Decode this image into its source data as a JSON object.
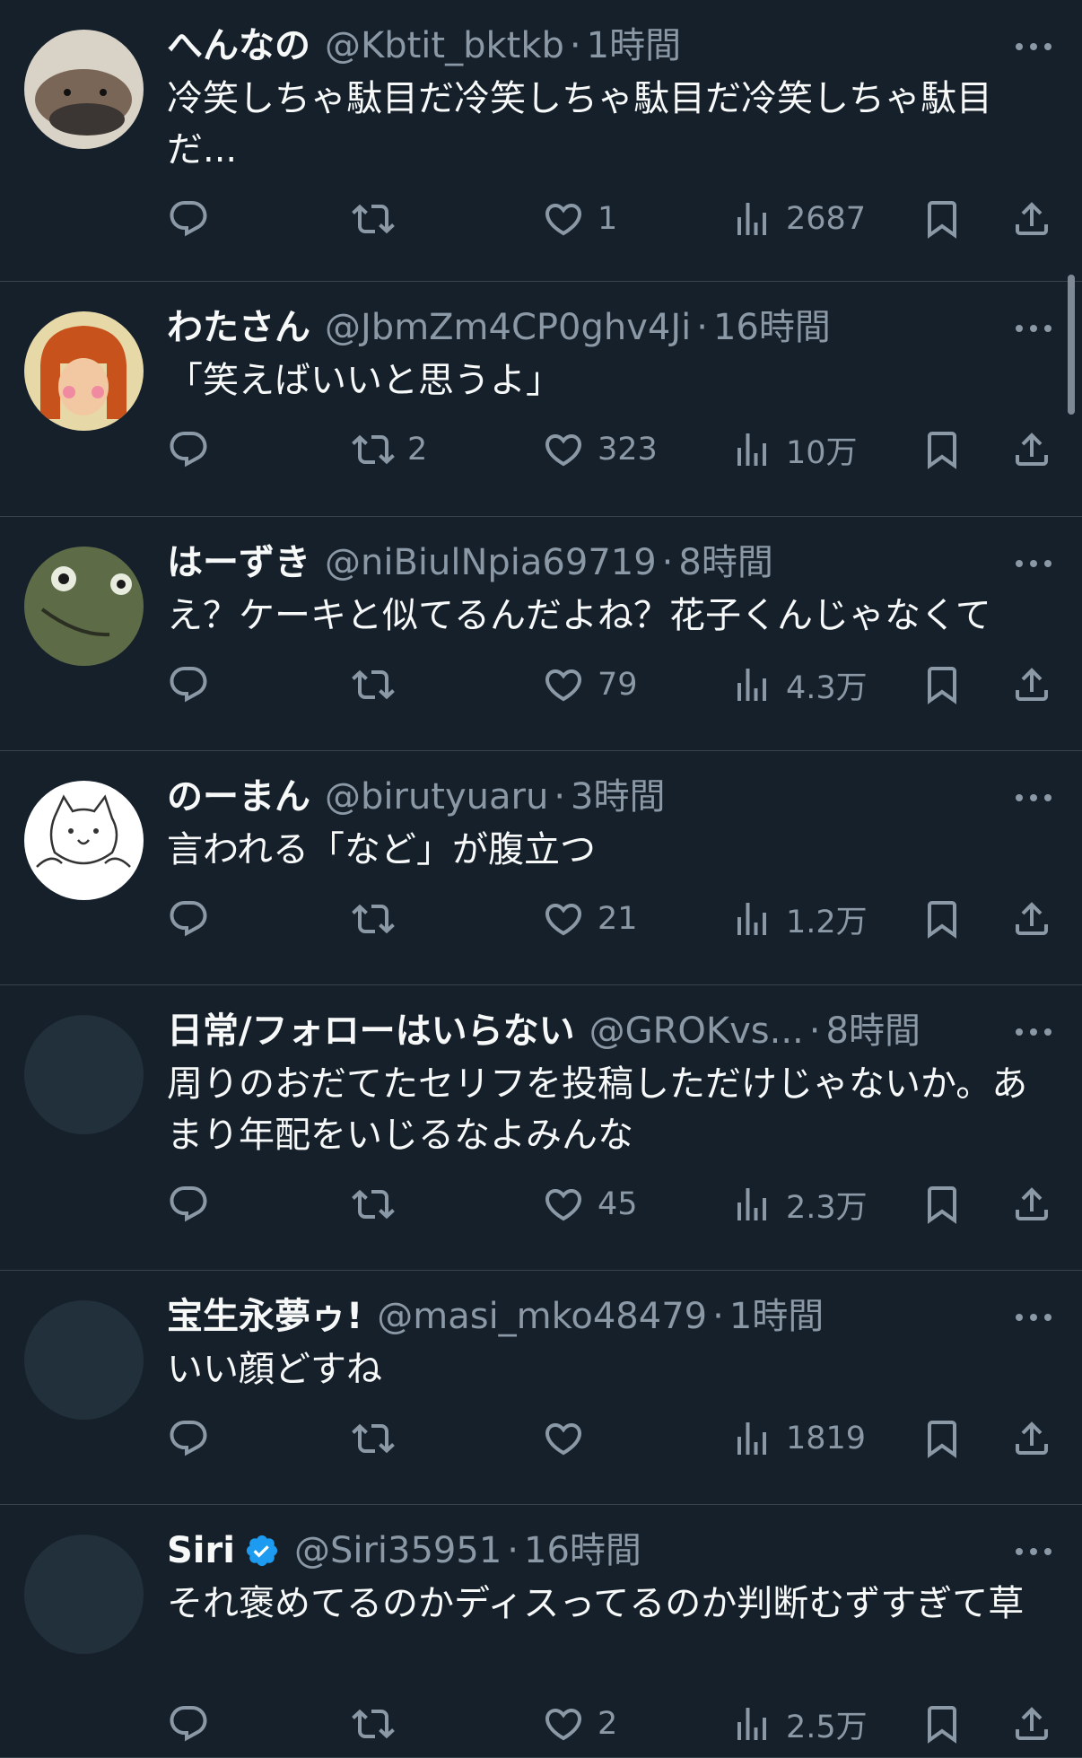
{
  "tweets": [
    {
      "name": "へんなの",
      "handle": "@Kbtit_bktkb",
      "time": "1時間",
      "text": "冷笑しちゃ駄目だ冷笑しちゃ駄目だ冷笑しちゃ駄目だ...",
      "retweets": "",
      "likes": "1",
      "views": "2687",
      "avatar": "platypus",
      "verified": false
    },
    {
      "name": "わたさん",
      "handle": "@JbmZm4CP0ghv4Ji",
      "time": "16時間",
      "text": "「笑えばいいと思うよ」",
      "retweets": "2",
      "likes": "323",
      "views": "10万",
      "avatar": "girl",
      "verified": false
    },
    {
      "name": "はーずき",
      "handle": "@niBiulNpia69719",
      "time": "8時間",
      "text": "え？ケーキと似てるんだよね？花子くんじゃなくて",
      "retweets": "",
      "likes": "79",
      "views": "4.3万",
      "avatar": "frog",
      "verified": false
    },
    {
      "name": "のーまん",
      "handle": "@birutyuaru",
      "time": "3時間",
      "text": "言われる「など」が腹立つ",
      "retweets": "",
      "likes": "21",
      "views": "1.2万",
      "avatar": "cat",
      "verified": false
    },
    {
      "name": "日常/フォローはいらない",
      "handle": "@GROKvs...",
      "time": "8時間",
      "text": "周りのおだてたセリフを投稿しただけじゃないか。あまり年配をいじるなよみんな",
      "retweets": "",
      "likes": "45",
      "views": "2.3万",
      "avatar": "blank",
      "verified": false
    },
    {
      "name": "宝生永夢ゥ!",
      "handle": "@masi_mko48479",
      "time": "1時間",
      "text": "いい顔どすね",
      "retweets": "",
      "likes": "",
      "views": "1819",
      "avatar": "blank",
      "verified": false
    },
    {
      "name": "Siri",
      "handle": "@Siri35951",
      "time": "16時間",
      "text": "それ褒めてるのかディスってるのか判断むずすぎて草",
      "retweets": "",
      "likes": "2",
      "views": "2.5万",
      "avatar": "blank",
      "verified": true
    }
  ],
  "icons": {
    "reply": "reply-icon",
    "retweet": "retweet-icon",
    "like": "heart-icon",
    "views": "views-icon",
    "bookmark": "bookmark-icon",
    "share": "share-icon",
    "more": "more-icon",
    "verified": "verified-badge-icon"
  },
  "colors": {
    "background": "#15202b",
    "text": "#f7f9f9",
    "secondary": "#8b98a5",
    "divider": "#38444d",
    "verified": "#1d9bf0"
  }
}
